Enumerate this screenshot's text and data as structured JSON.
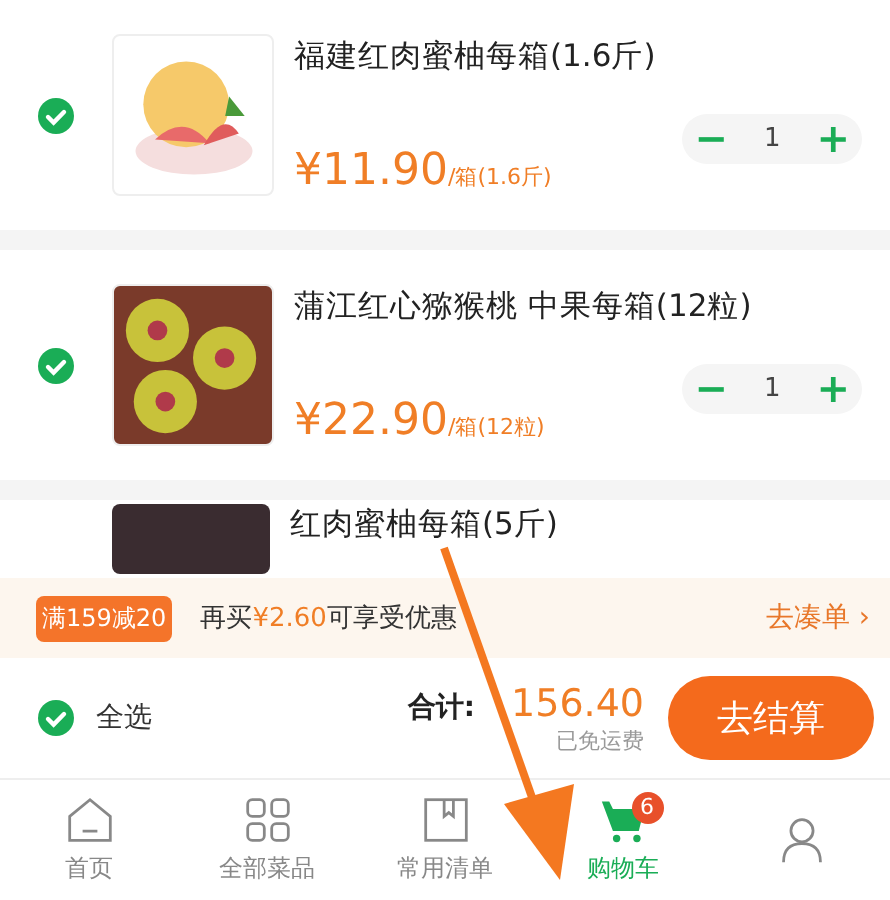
{
  "items": [
    {
      "title": "福建红肉蜜柚每箱(1.6斤)",
      "price": "¥11.90",
      "unit": "/箱(1.6斤)",
      "minus": "−",
      "quantity": "1",
      "plus": "+",
      "checked": true
    },
    {
      "title": "蒲江红心猕猴桃 中果每箱(12粒)",
      "price": "¥22.90",
      "unit": "/箱(12粒)",
      "minus": "−",
      "quantity": "1",
      "plus": "+",
      "checked": true
    },
    {
      "title": "红肉蜜柚每箱(5斤)"
    }
  ],
  "promo": {
    "tag": "满159减20",
    "text": "再买**¥2.60**可享受优惠",
    "link": "去凑单",
    "chevron": "›"
  },
  "footer": {
    "select_all": {
      "label": "全选",
      "checked": true
    },
    "total_label": "合计:",
    "total": "156.40",
    "shipping": "已免运费",
    "checkout": "去结算"
  },
  "tabs": [
    {
      "label": "首页",
      "selected": false
    },
    {
      "label": "全部菜品",
      "selected": false
    },
    {
      "label": "常用清单",
      "selected": false
    },
    {
      "label": "购物车",
      "selected": true,
      "badge": "6"
    },
    {
      "selected": false
    }
  ]
}
